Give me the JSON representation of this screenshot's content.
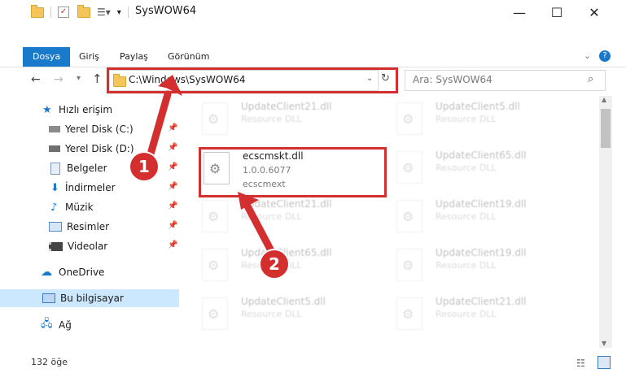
{
  "window": {
    "title": "SysWOW64"
  },
  "ribbon": {
    "tabs": [
      "Dosya",
      "Giriş",
      "Paylaş",
      "Görünüm"
    ]
  },
  "address": {
    "path": "C:\\Windows\\SysWOW64"
  },
  "search": {
    "placeholder": "Ara: SysWOW64"
  },
  "nav": {
    "items": [
      {
        "label": "Hızlı erişim"
      },
      {
        "label": "Yerel Disk (C:)"
      },
      {
        "label": "Yerel Disk (D:)"
      },
      {
        "label": "Belgeler"
      },
      {
        "label": "İndirmeler"
      },
      {
        "label": "Müzik"
      },
      {
        "label": "Resimler"
      },
      {
        "label": "Videolar"
      },
      {
        "label": "OneDrive"
      },
      {
        "label": "Bu bilgisayar"
      },
      {
        "label": "Ağ"
      }
    ]
  },
  "files": {
    "highlighted": {
      "name": "ecscmskt.dll",
      "version": "1.0.0.6077",
      "desc": "ecscmext"
    },
    "background": [
      {
        "name": "UpdateClient21.dll",
        "type": "Resource DLL"
      },
      {
        "name": "UpdateClient5.dll",
        "type": "Resource DLL"
      },
      {
        "name": "UpdateClient65.dll",
        "type": "Resource DLL"
      },
      {
        "name": "UpdateClient21.dll",
        "type": "Resource DLL"
      },
      {
        "name": "UpdateClient19.dll",
        "type": "Resource DLL"
      },
      {
        "name": "UpdateClient65.dll",
        "type": "Resource DLL"
      },
      {
        "name": "UpdateClient19.dll",
        "type": "Resource DLL"
      },
      {
        "name": "UpdateClient5.dll",
        "type": "Resource DLL"
      },
      {
        "name": "UpdateClient21.dll",
        "type": "Resource DLL"
      }
    ]
  },
  "status": {
    "count": "132 öğe"
  },
  "annotations": {
    "step1": "1",
    "step2": "2"
  }
}
